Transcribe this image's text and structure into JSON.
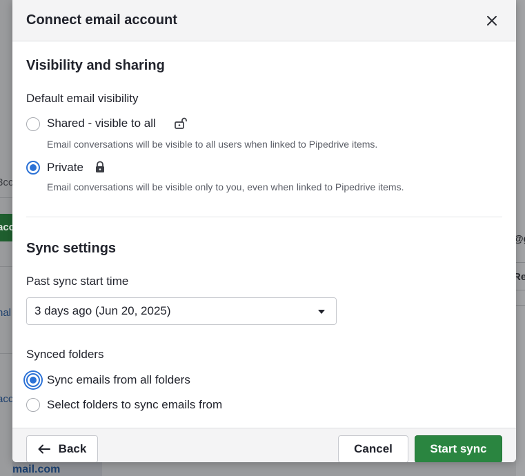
{
  "background": {
    "left_fragments": [
      "3cc",
      "acc",
      "nal",
      "acc"
    ],
    "right_fragments": [
      "@g",
      "Re"
    ],
    "bottom_fragment": "mail.com"
  },
  "modal": {
    "title": "Connect email account",
    "close_icon": "close-icon"
  },
  "visibility": {
    "section_title": "Visibility and sharing",
    "field_label": "Default email visibility",
    "options": [
      {
        "label": "Shared - visible to all",
        "icon": "unlock-icon",
        "description": "Email conversations will be visible to all users when linked to Pipedrive items.",
        "selected": false
      },
      {
        "label": "Private",
        "icon": "lock-icon",
        "description": "Email conversations will be visible only to you, even when linked to Pipedrive items.",
        "selected": true
      }
    ]
  },
  "sync": {
    "section_title": "Sync settings",
    "start_time_label": "Past sync start time",
    "start_time_value": "3 days ago (Jun 20, 2025)",
    "folders_label": "Synced folders",
    "folder_options": [
      {
        "label": "Sync emails from all folders",
        "selected": true
      },
      {
        "label": "Select folders to sync emails from",
        "selected": false
      }
    ]
  },
  "footer": {
    "back_label": "Back",
    "cancel_label": "Cancel",
    "start_label": "Start sync"
  },
  "colors": {
    "primary_green": "#2a8540",
    "radio_blue": "#2c72d6"
  }
}
